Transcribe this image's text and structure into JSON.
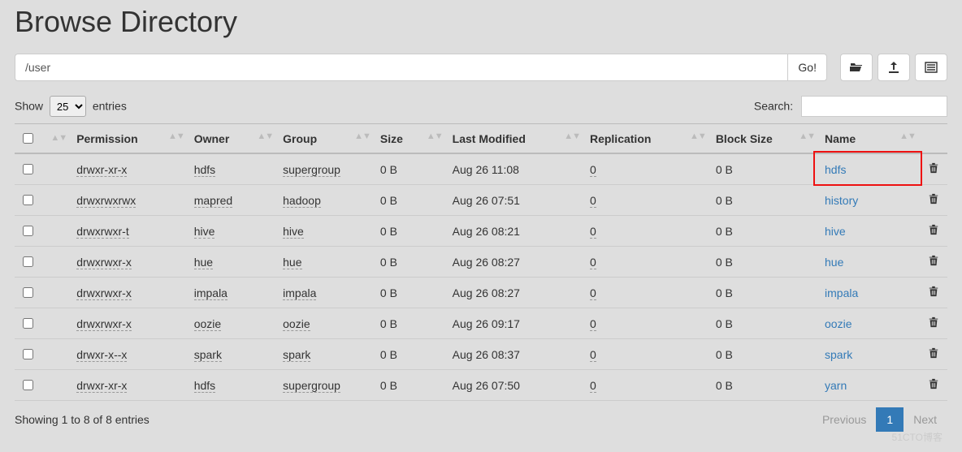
{
  "page": {
    "title": "Browse Directory",
    "path_value": "/user",
    "go_label": "Go!"
  },
  "toolbar_icons": [
    "home-icon",
    "upload-icon",
    "newdir-icon"
  ],
  "length_menu": {
    "show": "Show",
    "entries": "entries",
    "selected": "25"
  },
  "search": {
    "label": "Search:",
    "value": ""
  },
  "table": {
    "headers": {
      "permission": "Permission",
      "owner": "Owner",
      "group": "Group",
      "size": "Size",
      "last_modified": "Last Modified",
      "replication": "Replication",
      "block_size": "Block Size",
      "name": "Name"
    },
    "rows": [
      {
        "permission": "drwxr-xr-x",
        "owner": "hdfs",
        "group": "supergroup",
        "size": "0 B",
        "last_modified": "Aug 26 11:08",
        "replication": "0",
        "block_size": "0 B",
        "name": "hdfs",
        "highlight": true
      },
      {
        "permission": "drwxrwxrwx",
        "owner": "mapred",
        "group": "hadoop",
        "size": "0 B",
        "last_modified": "Aug 26 07:51",
        "replication": "0",
        "block_size": "0 B",
        "name": "history",
        "highlight": false
      },
      {
        "permission": "drwxrwxr-t",
        "owner": "hive",
        "group": "hive",
        "size": "0 B",
        "last_modified": "Aug 26 08:21",
        "replication": "0",
        "block_size": "0 B",
        "name": "hive",
        "highlight": false
      },
      {
        "permission": "drwxrwxr-x",
        "owner": "hue",
        "group": "hue",
        "size": "0 B",
        "last_modified": "Aug 26 08:27",
        "replication": "0",
        "block_size": "0 B",
        "name": "hue",
        "highlight": false
      },
      {
        "permission": "drwxrwxr-x",
        "owner": "impala",
        "group": "impala",
        "size": "0 B",
        "last_modified": "Aug 26 08:27",
        "replication": "0",
        "block_size": "0 B",
        "name": "impala",
        "highlight": false
      },
      {
        "permission": "drwxrwxr-x",
        "owner": "oozie",
        "group": "oozie",
        "size": "0 B",
        "last_modified": "Aug 26 09:17",
        "replication": "0",
        "block_size": "0 B",
        "name": "oozie",
        "highlight": false
      },
      {
        "permission": "drwxr-x--x",
        "owner": "spark",
        "group": "spark",
        "size": "0 B",
        "last_modified": "Aug 26 08:37",
        "replication": "0",
        "block_size": "0 B",
        "name": "spark",
        "highlight": false
      },
      {
        "permission": "drwxr-xr-x",
        "owner": "hdfs",
        "group": "supergroup",
        "size": "0 B",
        "last_modified": "Aug 26 07:50",
        "replication": "0",
        "block_size": "0 B",
        "name": "yarn",
        "highlight": false
      }
    ]
  },
  "footer": {
    "info": "Showing 1 to 8 of 8 entries",
    "prev": "Previous",
    "page": "1",
    "next": "Next"
  },
  "watermark": "51CTO博客"
}
